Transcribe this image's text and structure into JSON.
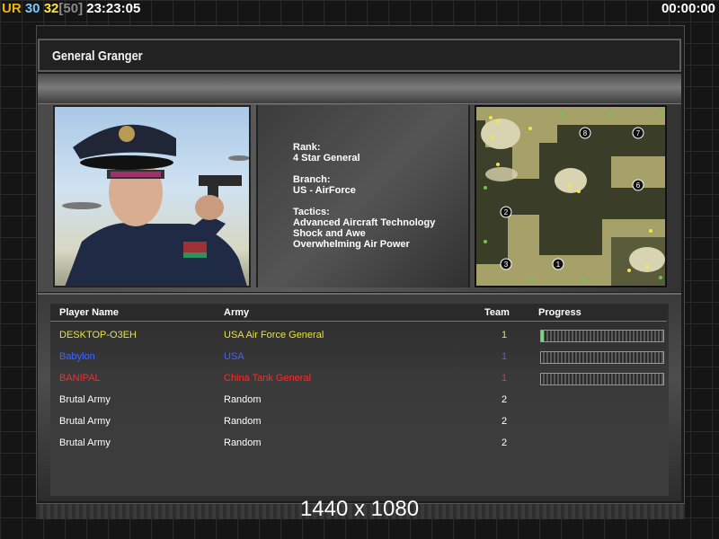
{
  "hud": {
    "ur_label": "UR",
    "value_a": "30",
    "value_b": "32",
    "value_c": "[50]",
    "clock": "23:23:05",
    "timer": "00:00:00"
  },
  "general": {
    "name": "General Granger",
    "rank_label": "Rank:",
    "rank": "4 Star General",
    "branch_label": "Branch:",
    "branch": "US - AirForce",
    "tactics_label": "Tactics:",
    "tactics": [
      "Advanced Aircraft Technology",
      "Shock and Awe",
      "Overwhelming Air Power"
    ]
  },
  "minimap": {
    "spawns": [
      "8",
      "7",
      "6",
      "2",
      "3",
      "1"
    ]
  },
  "table": {
    "headers": {
      "player": "Player Name",
      "army": "Army",
      "team": "Team",
      "progress": "Progress"
    },
    "rows": [
      {
        "name": "DESKTOP-O3EH",
        "army": "USA Air Force General",
        "team": "1",
        "progress": 0.02,
        "color": "#e8e23a"
      },
      {
        "name": "Babylon",
        "army": "USA",
        "team": "1",
        "progress": 0,
        "color": "#3e64ff"
      },
      {
        "name": "BANIPAL",
        "army": "China Tank General",
        "team": "1",
        "progress": 0,
        "color": "#ff2a2a"
      },
      {
        "name": "Brutal Army",
        "army": "Random",
        "team": "2",
        "color": "#ffffff"
      },
      {
        "name": "Brutal Army",
        "army": "Random",
        "team": "2",
        "color": "#ffffff"
      },
      {
        "name": "Brutal Army",
        "army": "Random",
        "team": "2",
        "color": "#ffffff"
      }
    ]
  },
  "overlay": {
    "resolution": "1440 x 1080"
  }
}
